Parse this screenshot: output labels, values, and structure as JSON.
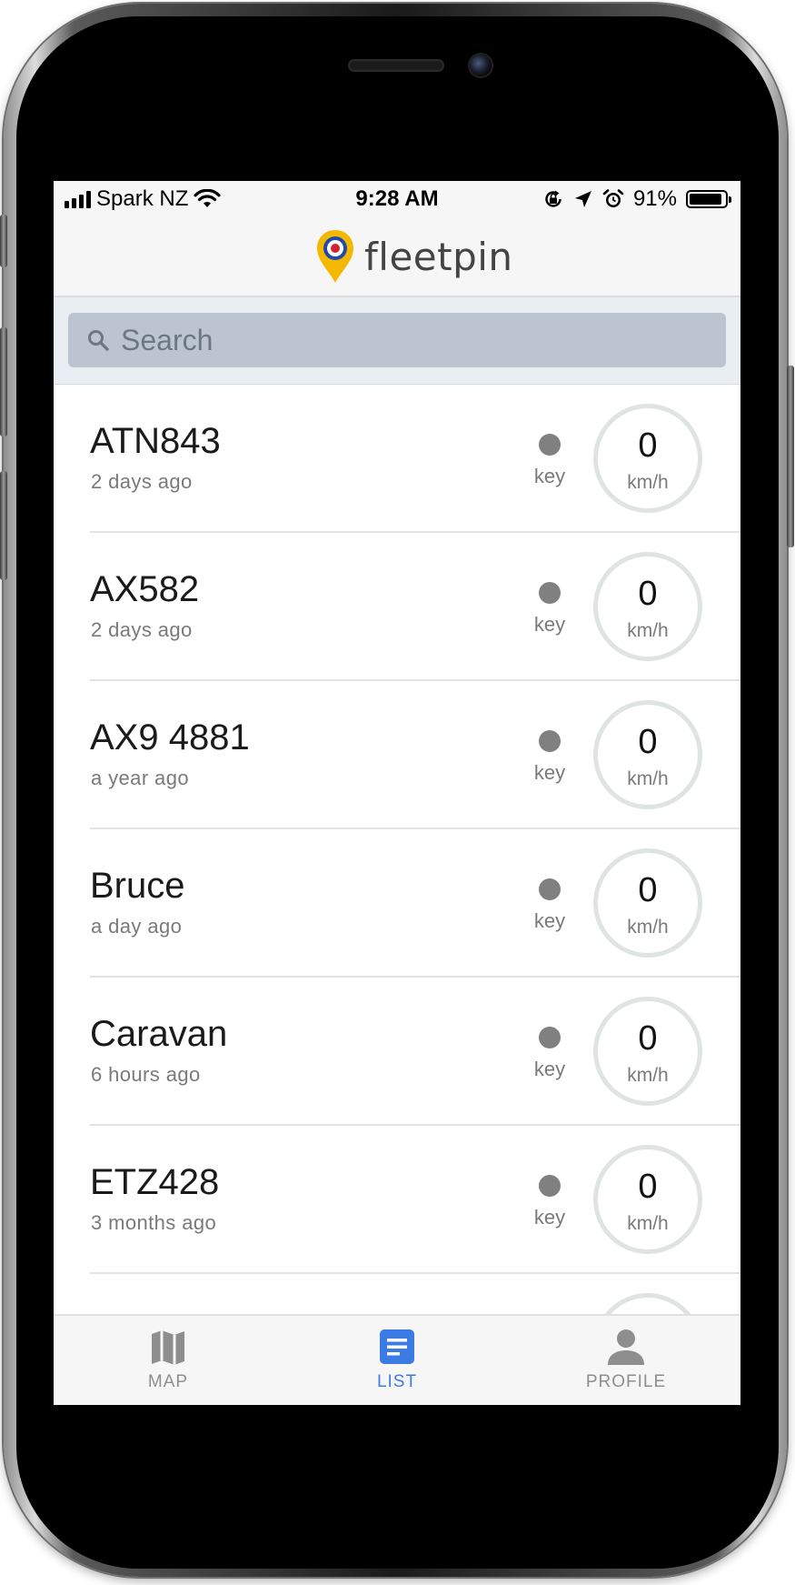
{
  "status_bar": {
    "carrier": "Spark NZ",
    "time": "9:28 AM",
    "battery": "91%",
    "battery_level": 0.91
  },
  "header": {
    "app_name": "fleetpin"
  },
  "search": {
    "placeholder": "Search",
    "value": ""
  },
  "vehicles": [
    {
      "name": "ATN843",
      "last_seen": "2 days ago",
      "key_label": "key",
      "speed": "0",
      "unit": "km/h"
    },
    {
      "name": "AX582",
      "last_seen": "2 days ago",
      "key_label": "key",
      "speed": "0",
      "unit": "km/h"
    },
    {
      "name": "AX9 4881",
      "last_seen": "a year ago",
      "key_label": "key",
      "speed": "0",
      "unit": "km/h"
    },
    {
      "name": "Bruce",
      "last_seen": "a day ago",
      "key_label": "key",
      "speed": "0",
      "unit": "km/h"
    },
    {
      "name": "Caravan",
      "last_seen": "6 hours ago",
      "key_label": "key",
      "speed": "0",
      "unit": "km/h"
    },
    {
      "name": "ETZ428",
      "last_seen": "3 months ago",
      "key_label": "key",
      "speed": "0",
      "unit": "km/h"
    }
  ],
  "tabs": [
    {
      "label": "MAP",
      "icon": "map-icon",
      "active": false
    },
    {
      "label": "LIST",
      "icon": "list-icon",
      "active": true
    },
    {
      "label": "PROFILE",
      "icon": "profile-icon",
      "active": false
    }
  ],
  "colors": {
    "accent": "#3c7be3",
    "logo_pin": "#f5b800",
    "logo_ring": "#1f4aa8",
    "logo_center": "#d0222f",
    "search_bg": "#bcc5cf",
    "key_dot": "#808080"
  }
}
